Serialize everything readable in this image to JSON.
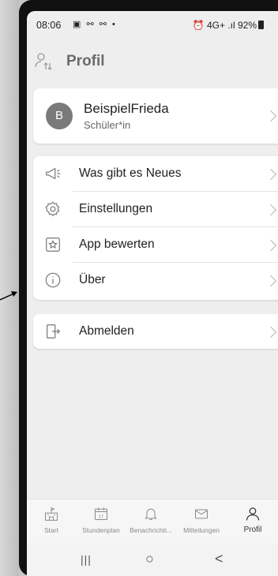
{
  "status_bar": {
    "time": "08:06",
    "left_icons": "▣ ⚯ ⚯ •",
    "right": "⏰ 4G+ .ıl 92%"
  },
  "header": {
    "title": "Profil",
    "icon": "profile-switch-icon"
  },
  "profile": {
    "avatar_initial": "B",
    "name": "BeispielFrieda",
    "role": "Schüler*in"
  },
  "menu": [
    {
      "label": "Was gibt es Neues",
      "icon": "megaphone-icon"
    },
    {
      "label": "Einstellungen",
      "icon": "gear-icon"
    },
    {
      "label": "App bewerten",
      "icon": "star-icon"
    },
    {
      "label": "Über",
      "icon": "info-icon"
    }
  ],
  "logout": {
    "label": "Abmelden",
    "icon": "logout-icon"
  },
  "bottom_nav": [
    {
      "label": "Start",
      "icon": "school-icon"
    },
    {
      "label": "Stundenplan",
      "icon": "calendar-icon",
      "day": "17"
    },
    {
      "label": "Benachrichti...",
      "icon": "bell-icon"
    },
    {
      "label": "Mitteilungen",
      "icon": "mail-icon"
    },
    {
      "label": "Profil",
      "icon": "person-icon",
      "active": true
    }
  ],
  "system_nav": {
    "recents": "|||",
    "home": "○",
    "back": "<"
  },
  "colors": {
    "background": "#eeeeee",
    "card": "#ffffff",
    "avatar": "#7a7a7a",
    "title": "#6b6b6b"
  }
}
